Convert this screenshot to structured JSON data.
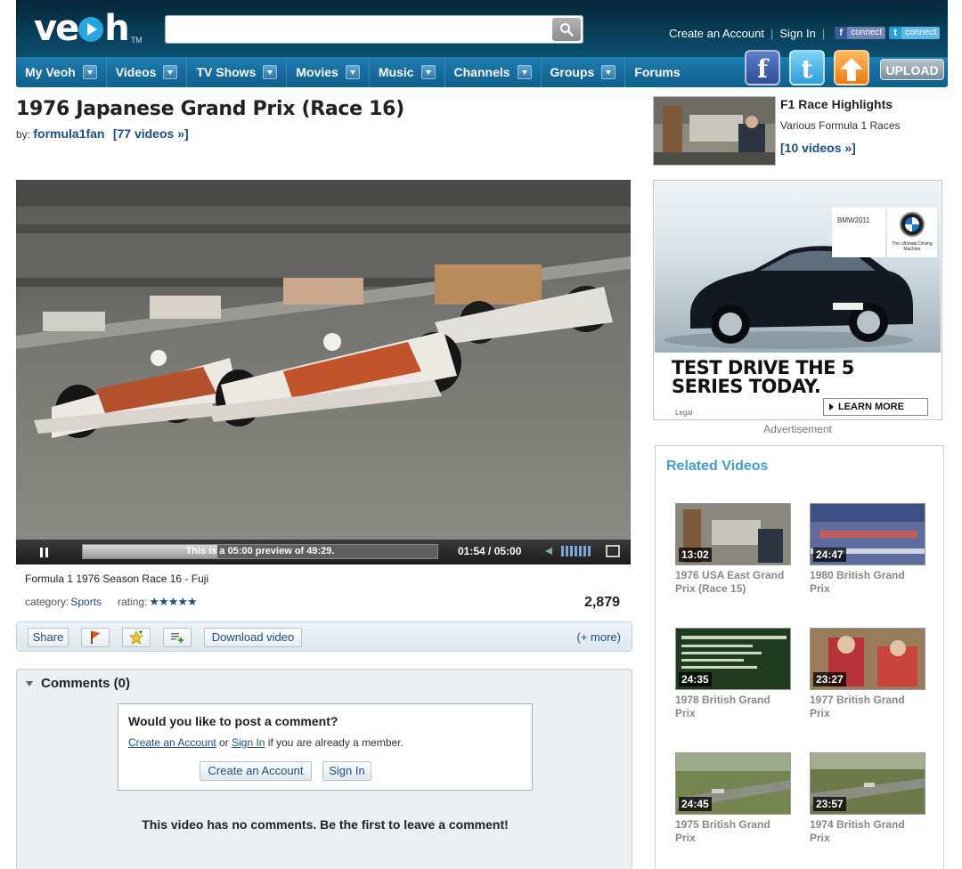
{
  "header": {
    "logo": "veoh",
    "logo_tm": "TM",
    "search_placeholder": "",
    "create_account": "Create an Account",
    "sign_in": "Sign In",
    "fb_connect": "connect",
    "tw_connect": "connect",
    "upload": "UPLOAD"
  },
  "nav": [
    {
      "label": "My Veoh"
    },
    {
      "label": "Videos"
    },
    {
      "label": "TV Shows"
    },
    {
      "label": "Movies"
    },
    {
      "label": "Music"
    },
    {
      "label": "Channels"
    },
    {
      "label": "Groups"
    },
    {
      "label": "Forums"
    }
  ],
  "video": {
    "title": "1976 Japanese Grand Prix (Race 16)",
    "by_label": "by:",
    "user": "formula1fan",
    "user_videos": "[77 videos »]",
    "player": {
      "preview_msg": "This is a 05:00 preview of 49:29.",
      "time": "01:54 / 05:00",
      "progress": 0.38
    },
    "description": "Formula 1 1976 Season Race 16 - Fuji",
    "category_label": "category:",
    "category": "Sports",
    "rating_label": "rating:",
    "rating_stars": "★★★★★",
    "views": "2,879"
  },
  "actions": {
    "share": "Share",
    "download": "Download video",
    "more": "(+ more)"
  },
  "comments": {
    "heading": "Comments (0)",
    "prompt": "Would you like to post a comment?",
    "create_link": "Create an Account",
    "or": "or",
    "signin_link": "Sign In",
    "member_text": "if you are already a member.",
    "create_btn": "Create an Account",
    "signin_btn": "Sign In",
    "empty": "This video has no comments. Be the first to leave a comment!"
  },
  "playlist": {
    "title": "F1 Race Highlights",
    "subtitle": "Various Formula 1 Races",
    "count": "[10 videos »]"
  },
  "ad": {
    "brand_text": "BMW2011",
    "logo_tagline": "The Ultimate Driving Machine",
    "headline_1": "TEST DRIVE THE 5",
    "headline_2": "SERIES TODAY.",
    "legal": "Legal",
    "cta": "LEARN MORE",
    "label": "Advertisement"
  },
  "related": {
    "title": "Related Videos",
    "items": [
      {
        "duration": "13:02",
        "title_1": "1976 USA East Grand",
        "title_2": "Prix (Race 15)"
      },
      {
        "duration": "24:47",
        "title_1": "1980 British Grand",
        "title_2": "Prix"
      },
      {
        "duration": "24:35",
        "title_1": "1978 British Grand",
        "title_2": "Prix"
      },
      {
        "duration": "23:27",
        "title_1": "1977 British Grand",
        "title_2": "Prix"
      },
      {
        "duration": "24:45",
        "title_1": "1975 British Grand",
        "title_2": "Prix"
      },
      {
        "duration": "23:57",
        "title_1": "1974 British Grand",
        "title_2": "Prix"
      }
    ]
  },
  "colors": {
    "header_dark": "#04273a",
    "nav_blue": "#1d7db2",
    "link_blue": "#1a4f86",
    "related_title": "#3e9ed8"
  }
}
